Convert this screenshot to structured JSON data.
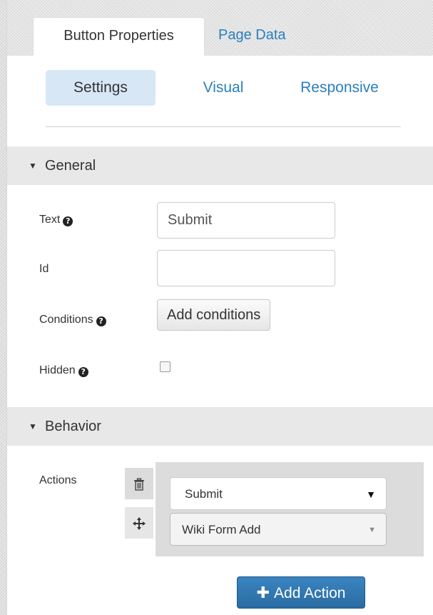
{
  "tabs": {
    "button_properties": "Button Properties",
    "page_data": "Page Data"
  },
  "subtabs": {
    "settings": "Settings",
    "visual": "Visual",
    "responsive": "Responsive"
  },
  "general": {
    "title": "General",
    "text_label": "Text",
    "text_value": "Submit",
    "id_label": "Id",
    "id_value": "",
    "conditions_label": "Conditions",
    "add_conditions": "Add conditions",
    "hidden_label": "Hidden",
    "hidden_checked": false
  },
  "behavior": {
    "title": "Behavior",
    "actions_label": "Actions",
    "action_type": "Submit",
    "action_target": "Wiki Form Add",
    "add_action": "Add Action"
  },
  "icons": {
    "help": "question-circle-icon",
    "caret": "caret-down-icon",
    "delete": "trash-icon",
    "move": "move-icon",
    "plus": "plus-icon"
  },
  "colors": {
    "link": "#2a7fbf",
    "active_pill": "#d7e7f5",
    "primary_button": "#2a6ca3",
    "section_header": "#e8e8e8"
  }
}
